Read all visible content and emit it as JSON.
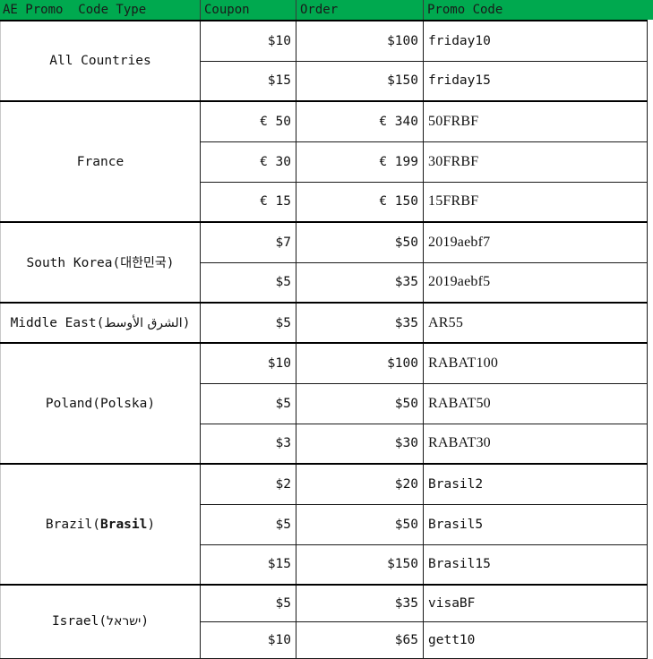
{
  "colors": {
    "header_green": "#00a94f",
    "text": "#111111",
    "grid_line": "#1a1a1a",
    "grid_line_light": "#c9c9c9"
  },
  "header": {
    "columns": [
      {
        "label": "AE Promo  Code Type",
        "align": "left",
        "name": "promo-code-type"
      },
      {
        "label": "Coupon",
        "align": "left",
        "name": "coupon"
      },
      {
        "label": "Order",
        "align": "left",
        "name": "order"
      },
      {
        "label": "Promo Code",
        "align": "left",
        "name": "promo-code"
      }
    ]
  },
  "table": {
    "groups": [
      {
        "country_plain": "All Countries",
        "country_html": "All Countries",
        "rows": [
          {
            "coupon": "$10",
            "order": "$100",
            "code": "friday10",
            "code_font": "mono"
          },
          {
            "coupon": "$15",
            "order": "$150",
            "code": "friday15",
            "code_font": "mono"
          }
        ]
      },
      {
        "country_plain": "France",
        "country_html": "France",
        "rows": [
          {
            "coupon": "€ 50",
            "order": "€ 340",
            "code": "50FRBF",
            "code_font": "cond"
          },
          {
            "coupon": "€ 30",
            "order": "€ 199",
            "code": "30FRBF",
            "code_font": "cond"
          },
          {
            "coupon": "€ 15",
            "order": "€ 150",
            "code": "15FRBF",
            "code_font": "cond"
          }
        ]
      },
      {
        "country_plain": "South Korea(대한민국)",
        "country_html": "South Korea(<span class=\"cjk\">대한민국</span>)",
        "rows": [
          {
            "coupon": "$7",
            "order": "$50",
            "code": "2019aebf7",
            "code_font": "cond"
          },
          {
            "coupon": "$5",
            "order": "$35",
            "code": "2019aebf5",
            "code_font": "cond"
          }
        ]
      },
      {
        "country_plain": "Middle East(الشرق الأوسط)",
        "country_html": "Middle East(<span class=\"rtl\">الشرق الأوسط</span>)",
        "rows": [
          {
            "coupon": "$5",
            "order": "$35",
            "code": "AR55",
            "code_font": "cond"
          }
        ]
      },
      {
        "country_plain": "Poland(Polska)",
        "country_html": "Poland(Polska)",
        "rows": [
          {
            "coupon": "$10",
            "order": "$100",
            "code": "RABAT100",
            "code_font": "cond"
          },
          {
            "coupon": "$5",
            "order": "$50",
            "code": "RABAT50",
            "code_font": "cond"
          },
          {
            "coupon": "$3",
            "order": "$30",
            "code": "RABAT30",
            "code_font": "cond"
          }
        ]
      },
      {
        "country_plain": "Brazil(Brasil)",
        "country_html": "Brazil(<span class=\"b\">Brasil</span>)",
        "rows": [
          {
            "coupon": "$2",
            "order": "$20",
            "code": "Brasil2",
            "code_font": "mono"
          },
          {
            "coupon": "$5",
            "order": "$50",
            "code": "Brasil5",
            "code_font": "mono"
          },
          {
            "coupon": "$15",
            "order": "$150",
            "code": "Brasil15",
            "code_font": "mono"
          }
        ]
      },
      {
        "country_plain": "Israel(ישראל)",
        "country_html": "Israel(<span class=\"rtl\">ישראל</span>)",
        "rows": [
          {
            "coupon": "$5",
            "order": "$35",
            "code": "visaBF",
            "code_font": "mono"
          },
          {
            "coupon": "$10",
            "order": "$65",
            "code": "gett10",
            "code_font": "mono"
          }
        ]
      }
    ]
  }
}
